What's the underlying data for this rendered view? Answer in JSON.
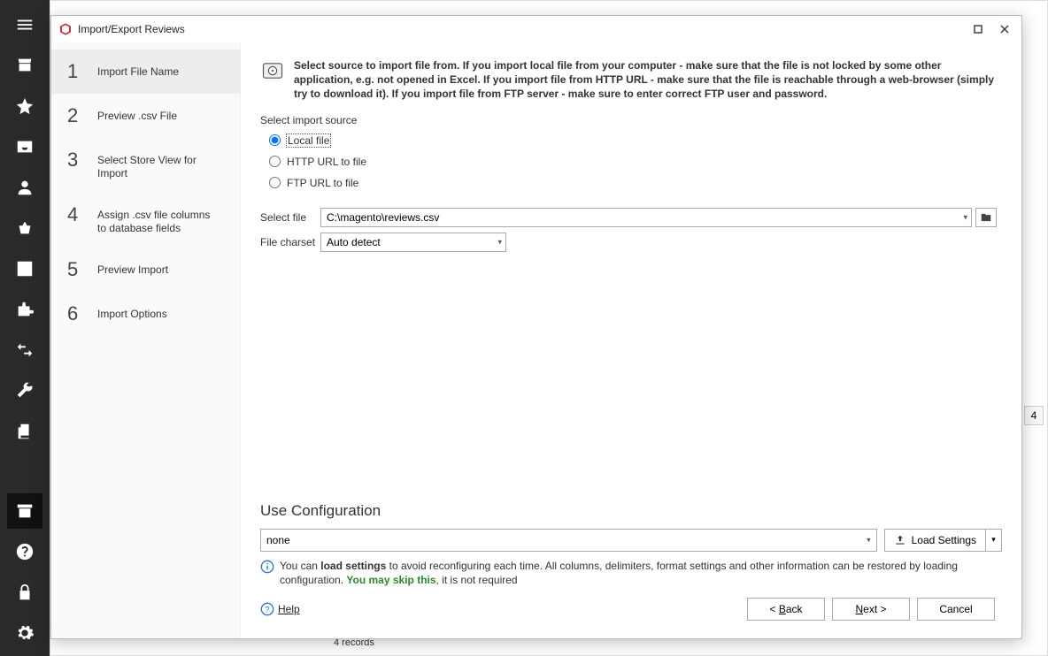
{
  "dialog": {
    "title": "Import/Export Reviews",
    "infoText": "Select source to import file from. If you import local file from your computer - make sure that the file is not locked by some other application, e.g. not opened in Excel. If you import file from HTTP URL - make sure that the file is reachable through a web-browser (simply try to download it). If you import file from FTP server - make sure to enter correct FTP user and password.",
    "sourceLabel": "Select import source",
    "radios": {
      "local": "Local file",
      "http": "HTTP URL to file",
      "ftp": "FTP URL to file"
    },
    "selectFileLabel": "Select file",
    "selectFileValue": "C:\\magento\\reviews.csv",
    "charsetLabel": "File charset",
    "charsetValue": "Auto detect",
    "useConfigTitle": "Use Configuration",
    "useConfigValue": "none",
    "loadSettingsLabel": "Load Settings",
    "ucInfoPre": "You can ",
    "ucInfoBold": "load settings",
    "ucInfoMid": " to avoid reconfiguring each time. All columns, delimiters, format settings and other information can be restored by loading configuration. ",
    "ucInfoGreen": "You may skip this",
    "ucInfoPost": ", it is not required",
    "helpLabel": "Help",
    "buttons": {
      "backPre": "< ",
      "backU": "B",
      "backPost": "ack",
      "nextU": "N",
      "nextPost": "ext >",
      "cancel": "Cancel"
    }
  },
  "wizardSteps": [
    {
      "num": "1",
      "label": "Import File Name"
    },
    {
      "num": "2",
      "label": "Preview .csv File"
    },
    {
      "num": "3",
      "label": "Select Store View for Import"
    },
    {
      "num": "4",
      "label": "Assign .csv file columns to database fields"
    },
    {
      "num": "5",
      "label": "Preview Import"
    },
    {
      "num": "6",
      "label": "Import Options"
    }
  ],
  "background": {
    "badge": "4",
    "records": "4 records"
  }
}
